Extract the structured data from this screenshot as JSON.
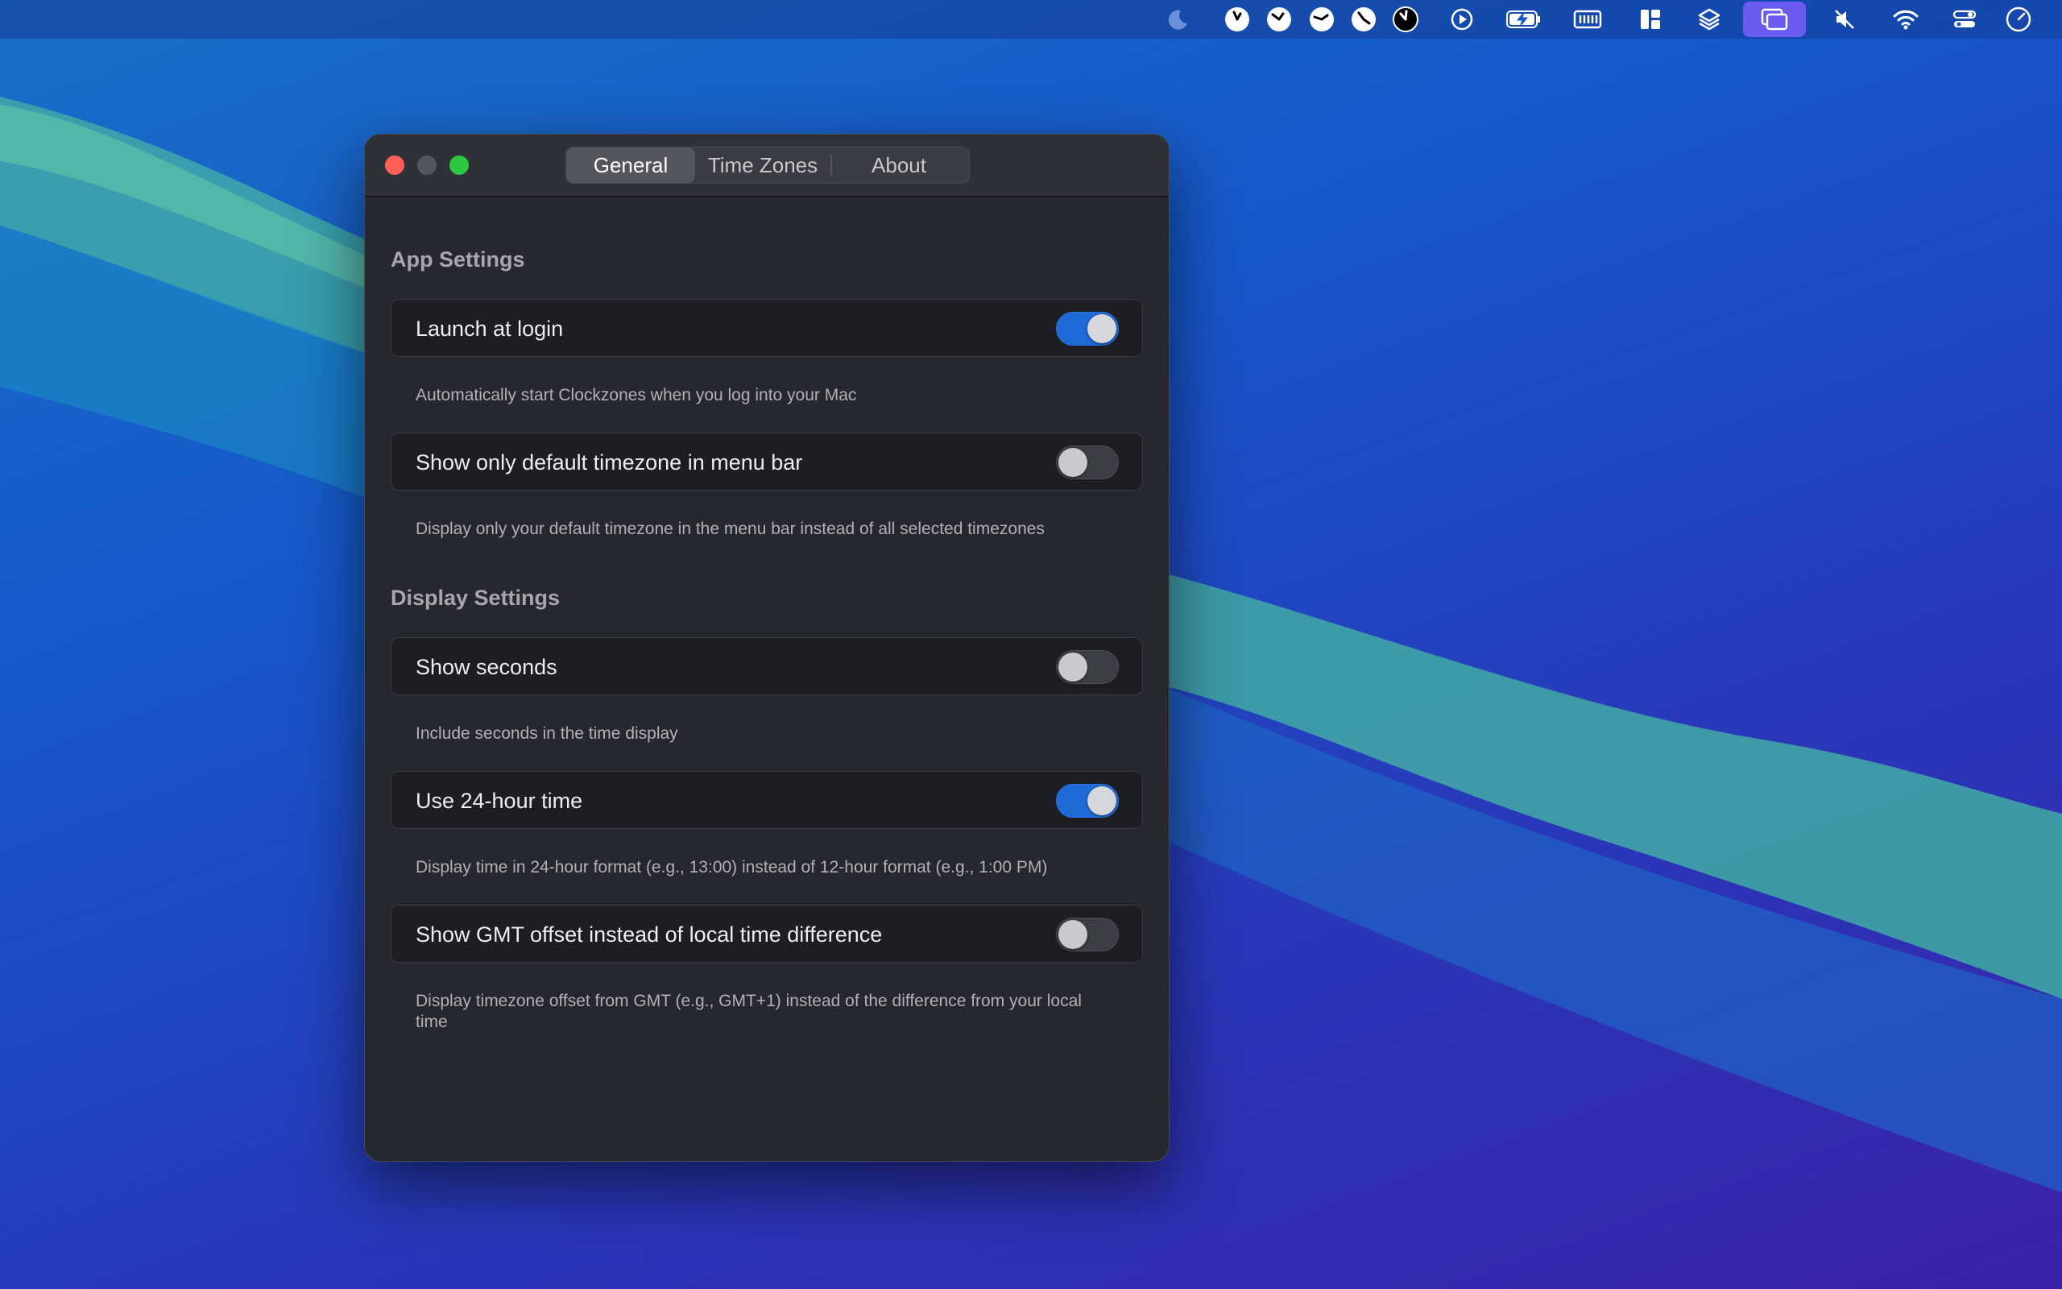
{
  "colors": {
    "toggle_on": "#1f6ad6",
    "window_bg": "#262830",
    "menubar_highlight": "#6a5cf0"
  },
  "menubar": {
    "icons": [
      "moon-icon",
      "clock-icon",
      "clock-icon",
      "clock-icon",
      "clock-icon",
      "clock-icon",
      "play-circle-icon",
      "battery-charging-icon",
      "keyboard-icon",
      "layout-icon",
      "layers-icon",
      "screens-icon",
      "mute-icon",
      "wifi-icon",
      "control-center-icon",
      "clock-outline-icon"
    ]
  },
  "window": {
    "tabs": [
      {
        "label": "General",
        "active": true
      },
      {
        "label": "Time Zones",
        "active": false
      },
      {
        "label": "About",
        "active": false
      }
    ],
    "sections": [
      {
        "title": "App Settings",
        "settings": [
          {
            "label": "Launch at login",
            "enabled": true,
            "description": "Automatically start Clockzones when you log into your Mac"
          },
          {
            "label": "Show only default timezone in menu bar",
            "enabled": false,
            "description": "Display only your default timezone in the menu bar instead of all selected timezones"
          }
        ]
      },
      {
        "title": "Display Settings",
        "settings": [
          {
            "label": "Show seconds",
            "enabled": false,
            "description": "Include seconds in the time display"
          },
          {
            "label": "Use 24-hour time",
            "enabled": true,
            "description": "Display time in 24-hour format (e.g., 13:00) instead of 12-hour format (e.g., 1:00 PM)"
          },
          {
            "label": "Show GMT offset instead of local time difference",
            "enabled": false,
            "description": "Display timezone offset from GMT (e.g., GMT+1) instead of the difference from your local time"
          }
        ]
      }
    ]
  }
}
